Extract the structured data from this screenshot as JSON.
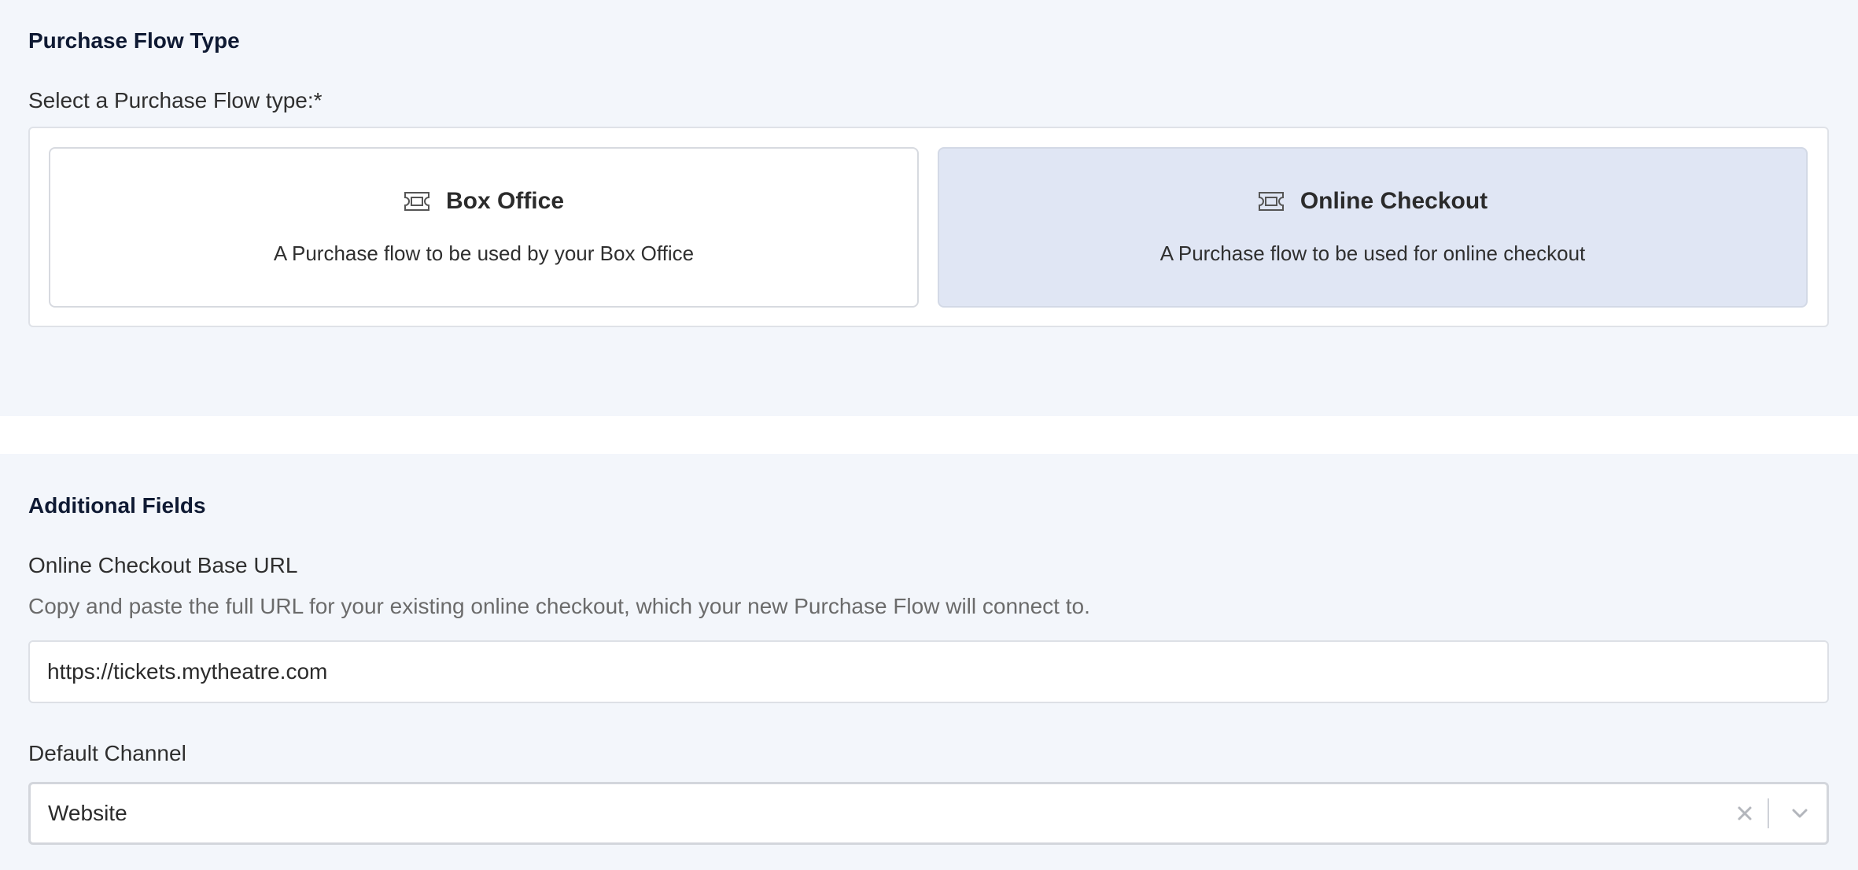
{
  "purchase_flow": {
    "section_title": "Purchase Flow Type",
    "select_label": "Select a Purchase Flow type:*",
    "options": [
      {
        "icon": "ticket-icon",
        "title": "Box Office",
        "description": "A Purchase flow to be used by your Box Office",
        "selected": false
      },
      {
        "icon": "ticket-icon",
        "title": "Online Checkout",
        "description": "A Purchase flow to be used for online checkout",
        "selected": true
      }
    ]
  },
  "additional_fields": {
    "section_title": "Additional Fields",
    "base_url": {
      "label": "Online Checkout Base URL",
      "help": "Copy and paste the full URL for your existing online checkout, which your new Purchase Flow will connect to.",
      "value": "https://tickets.mytheatre.com"
    },
    "default_channel": {
      "label": "Default Channel",
      "value": "Website",
      "clear_icon": "close-icon",
      "dropdown_icon": "chevron-down-icon"
    }
  },
  "colors": {
    "panel_bg": "#f3f6fb",
    "selected_card_bg": "#e0e6f4",
    "heading": "#0f1a33",
    "help_text": "#6b6b6b"
  }
}
